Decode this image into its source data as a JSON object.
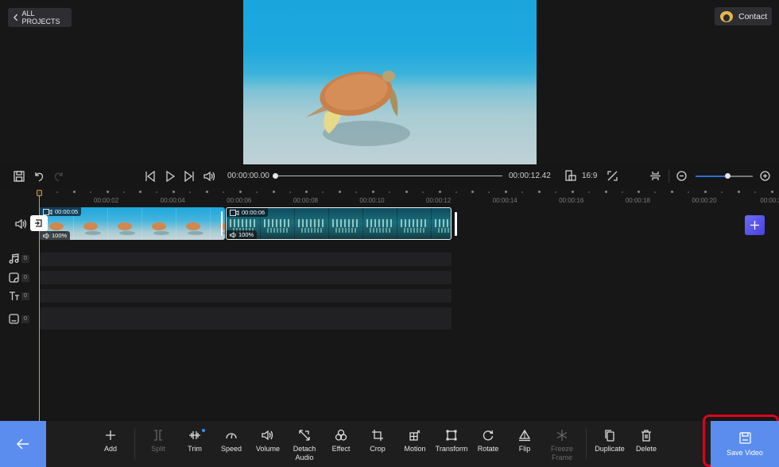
{
  "header": {
    "back_label": "ALL PROJECTS",
    "contact_label": "Contact"
  },
  "preview": {
    "description": "Sea turtle swimming over sandy seabed"
  },
  "playback": {
    "current_time": "00:00:00.00",
    "total_time": "00:00:12.42",
    "aspect_ratio": "16:9",
    "progress_fraction": 0.0,
    "zoom_level_fraction": 0.56
  },
  "ruler": {
    "labels": [
      "00:00:02",
      "00:00:04",
      "00:00:06",
      "00:00:08",
      "00:00:10",
      "00:00:12",
      "00:00:14",
      "00:00:16",
      "00:00:18",
      "00:00:20",
      "00:00:2"
    ]
  },
  "timeline": {
    "clips": [
      {
        "duration": "00:00:05",
        "volume": "100%",
        "type": "turtle",
        "selected": false
      },
      {
        "duration": "00:00:06",
        "volume": "100%",
        "type": "fish",
        "selected": true
      }
    ],
    "tracks": [
      {
        "name": "music",
        "count": "0"
      },
      {
        "name": "sticker",
        "count": "0"
      },
      {
        "name": "text",
        "count": "0"
      },
      {
        "name": "subtitle",
        "count": "0"
      }
    ]
  },
  "toolbar": {
    "tools": [
      {
        "id": "add",
        "label": "Add",
        "disabled": false
      },
      {
        "id": "split",
        "label": "Split",
        "disabled": true
      },
      {
        "id": "trim",
        "label": "Trim",
        "disabled": false,
        "badge": true
      },
      {
        "id": "speed",
        "label": "Speed",
        "disabled": false
      },
      {
        "id": "volume",
        "label": "Volume",
        "disabled": false
      },
      {
        "id": "detach-audio",
        "label": "Detach Audio",
        "disabled": false
      },
      {
        "id": "effect",
        "label": "Effect",
        "disabled": false
      },
      {
        "id": "crop",
        "label": "Crop",
        "disabled": false
      },
      {
        "id": "motion",
        "label": "Motion",
        "disabled": false
      },
      {
        "id": "transform",
        "label": "Transform",
        "disabled": false
      },
      {
        "id": "rotate",
        "label": "Rotate",
        "disabled": false
      },
      {
        "id": "flip",
        "label": "Flip",
        "disabled": false
      },
      {
        "id": "freeze-frame",
        "label": "Freeze Frame",
        "disabled": true
      },
      {
        "id": "duplicate",
        "label": "Duplicate",
        "disabled": false
      },
      {
        "id": "delete",
        "label": "Delete",
        "disabled": false
      }
    ],
    "save_label": "Save Video"
  },
  "colors": {
    "accent": "#5b8def",
    "add_track": "#5b5ff0",
    "playhead": "#e0a040",
    "highlight": "#e0001b"
  }
}
